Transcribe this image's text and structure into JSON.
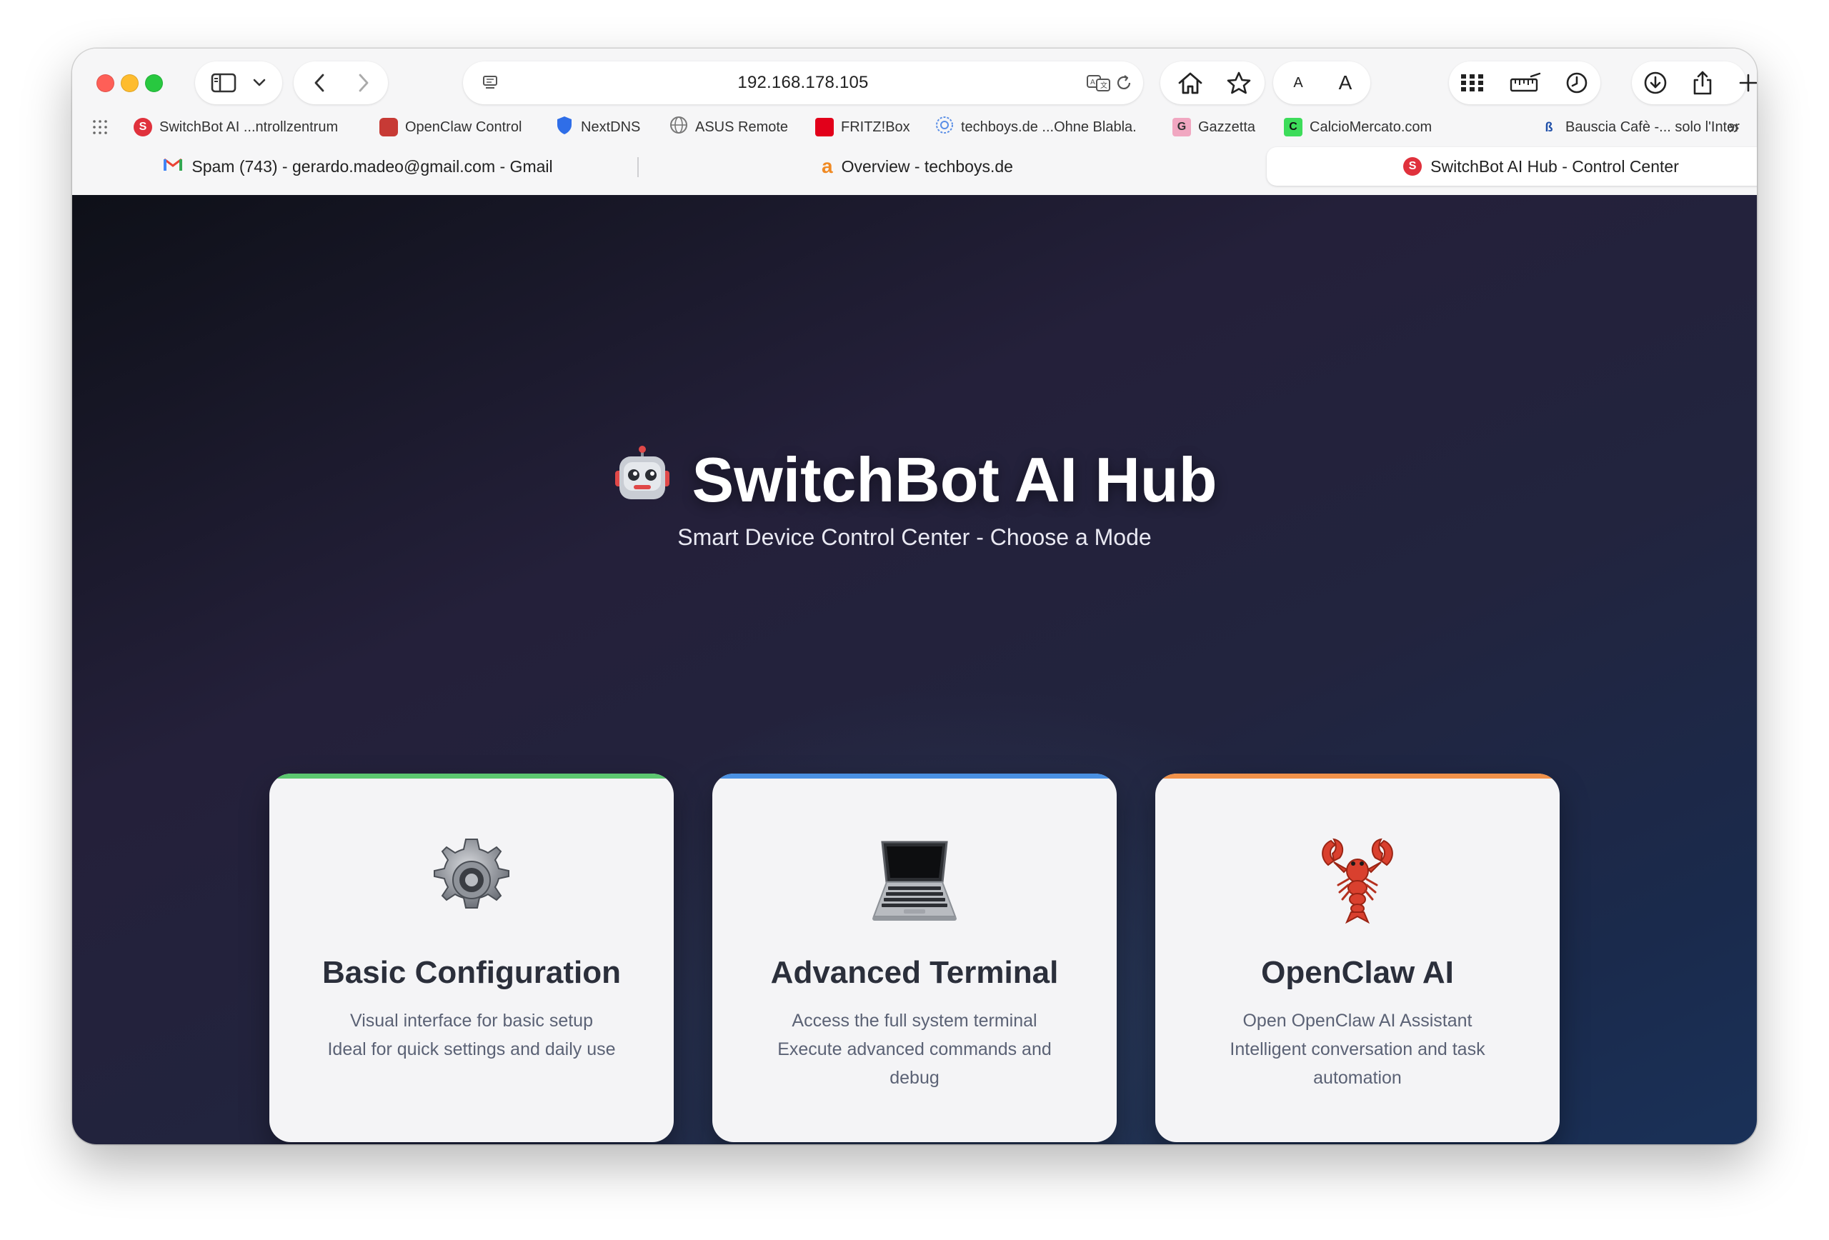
{
  "browser": {
    "url": "192.168.178.105",
    "bookmarks": [
      {
        "label": "SwitchBot AI ...ntrollzentrum",
        "icon": "switchbot-favicon"
      },
      {
        "label": "OpenClaw Control",
        "icon": "openclaw-favicon"
      },
      {
        "label": "NextDNS",
        "icon": "shield-favicon"
      },
      {
        "label": "ASUS Remote",
        "icon": "globe-favicon"
      },
      {
        "label": "FRITZ!Box",
        "icon": "fritzbox-favicon"
      },
      {
        "label": "techboys.de ...Ohne Blabla.",
        "icon": "techboys-favicon"
      },
      {
        "label": "Gazzetta",
        "icon": "gazzetta-favicon"
      },
      {
        "label": "CalcioMercato.com",
        "icon": "calciomercato-favicon"
      },
      {
        "label": "Bauscia Cafè -... solo l'Inter",
        "icon": "bauscia-favicon"
      }
    ],
    "tabs": [
      {
        "label": "Spam (743) - gerardo.madeo@gmail.com - Gmail",
        "icon": "gmail-favicon",
        "active": false
      },
      {
        "label": "Overview - techboys.de",
        "icon": "techboys-favicon",
        "active": false
      },
      {
        "label": "SwitchBot AI Hub - Control Center",
        "icon": "switchbot-favicon",
        "active": true
      }
    ]
  },
  "page": {
    "title": "SwitchBot AI Hub",
    "title_icon": "robot-icon",
    "subtitle": "Smart Device Control Center - Choose a Mode",
    "cards": [
      {
        "title": "Basic Configuration",
        "icon": "gear-icon",
        "accent": "#5cc770",
        "lines": [
          "Visual interface for basic setup",
          "Ideal for quick settings and daily use"
        ]
      },
      {
        "title": "Advanced Terminal",
        "icon": "laptop-icon",
        "accent": "#4a90e2",
        "lines": [
          "Access the full system terminal",
          "Execute advanced commands and",
          "debug"
        ]
      },
      {
        "title": "OpenClaw AI",
        "icon": "lobster-icon",
        "accent": "#f0914a",
        "lines": [
          "Open OpenClaw AI Assistant",
          "Intelligent conversation and task",
          "automation"
        ]
      }
    ]
  }
}
